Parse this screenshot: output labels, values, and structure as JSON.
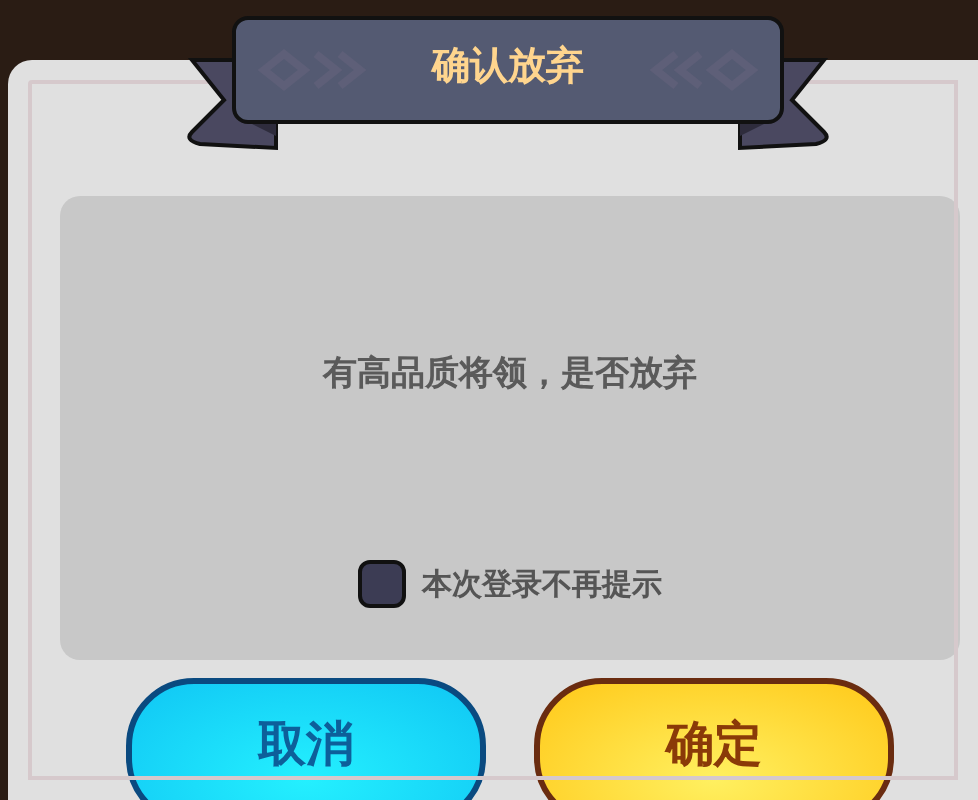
{
  "dialog": {
    "title": "确认放弃",
    "message": "有高品质将领，是否放弃",
    "dont_show_again": {
      "label": "本次登录不再提示",
      "checked": false
    },
    "buttons": [
      {
        "label": "取消",
        "kind": "cancel"
      },
      {
        "label": "确定",
        "kind": "confirm"
      }
    ]
  }
}
